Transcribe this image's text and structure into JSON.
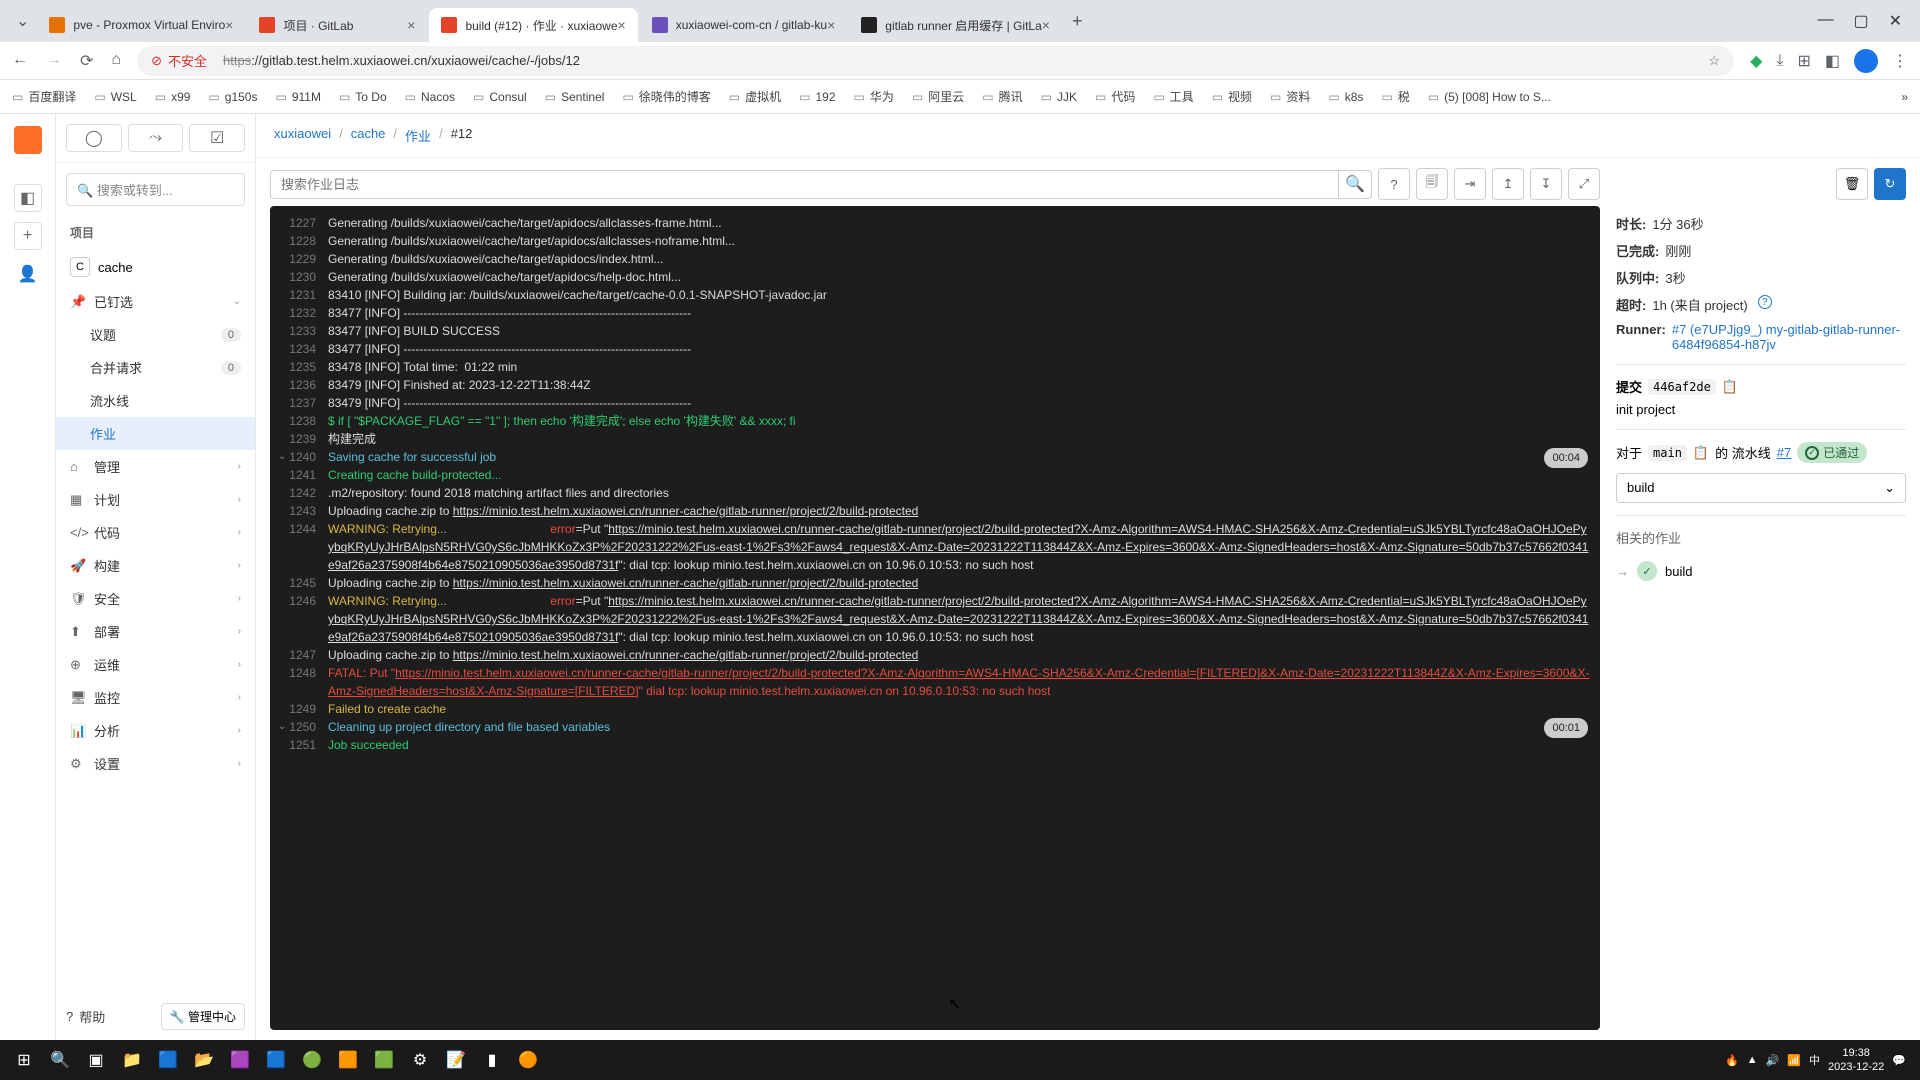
{
  "browser": {
    "tabs": [
      {
        "title": "pve - Proxmox Virtual Enviro",
        "color": "#e57200"
      },
      {
        "title": "项目 · GitLab",
        "color": "#e24329"
      },
      {
        "title": "build (#12) · 作业 · xuxiaowe",
        "color": "#e24329",
        "active": true
      },
      {
        "title": "xuxiaowei-com-cn / gitlab-ku",
        "color": "#6b4fbb"
      },
      {
        "title": "gitlab runner 启用缓存 | GitLa",
        "color": "#222"
      }
    ],
    "url_prefix": "https",
    "url_rest": "://gitlab.test.helm.xuxiaowei.cn/xuxiaowei/cache/-/jobs/12",
    "unsafe_label": "不安全",
    "bookmarks": [
      "百度翻译",
      "WSL",
      "x99",
      "g150s",
      "911M",
      "To Do",
      "Nacos",
      "Consul",
      "Sentinel",
      "徐晓伟的博客",
      "虚拟机",
      "192",
      "华为",
      "阿里云",
      "腾讯",
      "JJK",
      "代码",
      "工具",
      "视频",
      "资料",
      "k8s",
      "税",
      "(5) [008] How to S..."
    ]
  },
  "gitlab": {
    "breadcrumb": {
      "p0": "xuxiaowei",
      "p1": "cache",
      "p2": "作业",
      "p3": "#12"
    },
    "search_placeholder": "搜索或转到...",
    "section_project": "项目",
    "project_letter": "C",
    "project_name": "cache",
    "pinned_label": "已钉选",
    "nav": {
      "issues": "议题",
      "issues_count": "0",
      "mr": "合并请求",
      "mr_count": "0",
      "pipelines": "流水线",
      "jobs": "作业",
      "manage": "管理",
      "plan": "计划",
      "code": "代码",
      "build": "构建",
      "security": "安全",
      "deploy": "部署",
      "operate": "运维",
      "monitor": "监控",
      "analyze": "分析",
      "settings": "设置"
    },
    "help": "帮助",
    "admin": "管理中心"
  },
  "log": {
    "search_placeholder": "搜索作业日志",
    "lines": [
      {
        "n": 1227,
        "t": "Generating /builds/xuxiaowei/cache/target/apidocs/allclasses-frame.html..."
      },
      {
        "n": 1228,
        "t": "Generating /builds/xuxiaowei/cache/target/apidocs/allclasses-noframe.html..."
      },
      {
        "n": 1229,
        "t": "Generating /builds/xuxiaowei/cache/target/apidocs/index.html..."
      },
      {
        "n": 1230,
        "t": "Generating /builds/xuxiaowei/cache/target/apidocs/help-doc.html..."
      },
      {
        "n": 1231,
        "t": "83410 [INFO] Building jar: /builds/xuxiaowei/cache/target/cache-0.0.1-SNAPSHOT-javadoc.jar"
      },
      {
        "n": 1232,
        "t": "83477 [INFO] ------------------------------------------------------------------------"
      },
      {
        "n": 1233,
        "t": "83477 [INFO] BUILD SUCCESS"
      },
      {
        "n": 1234,
        "t": "83477 [INFO] ------------------------------------------------------------------------"
      },
      {
        "n": 1235,
        "t": "83478 [INFO] Total time:  01:22 min"
      },
      {
        "n": 1236,
        "t": "83479 [INFO] Finished at: 2023-12-22T11:38:44Z"
      },
      {
        "n": 1237,
        "t": "83479 [INFO] ------------------------------------------------------------------------"
      },
      {
        "n": 1238,
        "t": "$ if [ \"$PACKAGE_FLAG\" == \"1\" ]; then echo '构建完成'; else echo '构建失败' && xxxx; fi",
        "cls": "c-green"
      },
      {
        "n": 1239,
        "t": "构建完成"
      },
      {
        "n": 1240,
        "t": "Saving cache for successful job",
        "cls": "c-cyan",
        "section": true,
        "dur": "00:04"
      },
      {
        "n": 1241,
        "t": "Creating cache build-protected...",
        "cls": "c-green"
      },
      {
        "n": 1242,
        "t": ".m2/repository: found 2018 matching artifact files and directories"
      },
      {
        "n": 1243,
        "pre": "Uploading cache.zip to ",
        "link": "https://minio.test.helm.xuxiaowei.cn/runner-cache/gitlab-runner/project/2/build-protected"
      },
      {
        "n": 1244,
        "warn": "WARNING: Retrying...                               ",
        "err": "error",
        "mid": "=Put \"",
        "link": "https://minio.test.helm.xuxiaowei.cn/runner-cache/gitlab-runner/project/2/build-protected?X-Amz-Algorithm=AWS4-HMAC-SHA256&X-Amz-Credential=uSJk5YBLTyrcfc48aOaOHJOePyybqKRyUyJHrBAlpsN5RHVG0yS6cJbMHKKoZx3P%2F20231222%2Fus-east-1%2Fs3%2Faws4_request&X-Amz-Date=20231222T113844Z&X-Amz-Expires=3600&X-Amz-SignedHeaders=host&X-Amz-Signature=50db7b37c57662f0341e9af26a2375908f4b64e8750210905036ae3950d8731f",
        "post": "\": dial tcp: lookup minio.test.helm.xuxiaowei.cn on 10.96.0.10:53: no such host"
      },
      {
        "n": 1245,
        "pre": "Uploading cache.zip to ",
        "link": "https://minio.test.helm.xuxiaowei.cn/runner-cache/gitlab-runner/project/2/build-protected"
      },
      {
        "n": 1246,
        "warn": "WARNING: Retrying...                               ",
        "err": "error",
        "mid": "=Put \"",
        "link": "https://minio.test.helm.xuxiaowei.cn/runner-cache/gitlab-runner/project/2/build-protected?X-Amz-Algorithm=AWS4-HMAC-SHA256&X-Amz-Credential=uSJk5YBLTyrcfc48aOaOHJOePyybqKRyUyJHrBAlpsN5RHVG0yS6cJbMHKKoZx3P%2F20231222%2Fus-east-1%2Fs3%2Faws4_request&X-Amz-Date=20231222T113844Z&X-Amz-Expires=3600&X-Amz-SignedHeaders=host&X-Amz-Signature=50db7b37c57662f0341e9af26a2375908f4b64e8750210905036ae3950d8731f",
        "post": "\": dial tcp: lookup minio.test.helm.xuxiaowei.cn on 10.96.0.10:53: no such host"
      },
      {
        "n": 1247,
        "pre": "Uploading cache.zip to ",
        "link": "https://minio.test.helm.xuxiaowei.cn/runner-cache/gitlab-runner/project/2/build-protected"
      },
      {
        "n": 1248,
        "fatal": "FATAL: Put \"",
        "link": "https://minio.test.helm.xuxiaowei.cn/runner-cache/gitlab-runner/project/2/build-protected?X-Amz-Algorithm=AWS4-HMAC-SHA256&X-Amz-Credential=[FILTERED]&X-Amz-Date=20231222T113844Z&X-Amz-Expires=3600&X-Amz-SignedHeaders=host&X-Amz-Signature=[FILTERED]",
        "post": "\" dial tcp: lookup minio.test.helm.xuxiaowei.cn on 10.96.0.10:53: no such host"
      },
      {
        "n": 1249,
        "t": "Failed to create cache",
        "cls": "c-yellow"
      },
      {
        "n": 1250,
        "t": "Cleaning up project directory and file based variables",
        "cls": "c-cyan",
        "section": true,
        "dur": "00:01"
      },
      {
        "n": 1251,
        "t": "Job succeeded",
        "cls": "c-green"
      }
    ]
  },
  "job_sidebar": {
    "duration_label": "时长:",
    "duration": "1分 36秒",
    "finished_label": "已完成:",
    "finished": "刚刚",
    "queued_label": "队列中:",
    "queued": "3秒",
    "timeout_label": "超时:",
    "timeout": "1h (来自 project)",
    "runner_label": "Runner:",
    "runner": "#7 (e7UPJjg9_) my-gitlab-gitlab-runner-6484f96854-h87jv",
    "commit_label": "提交",
    "commit_sha": "446af2de",
    "commit_msg": "init project",
    "for_label": "对于",
    "branch": "main",
    "pipeline_word": "的 流水线",
    "pipeline_id": "#7",
    "passed": "已通过",
    "stage": "build",
    "related_label": "相关的作业",
    "related_job": "build"
  },
  "taskbar": {
    "time": "19:38",
    "date": "2023-12-22"
  }
}
